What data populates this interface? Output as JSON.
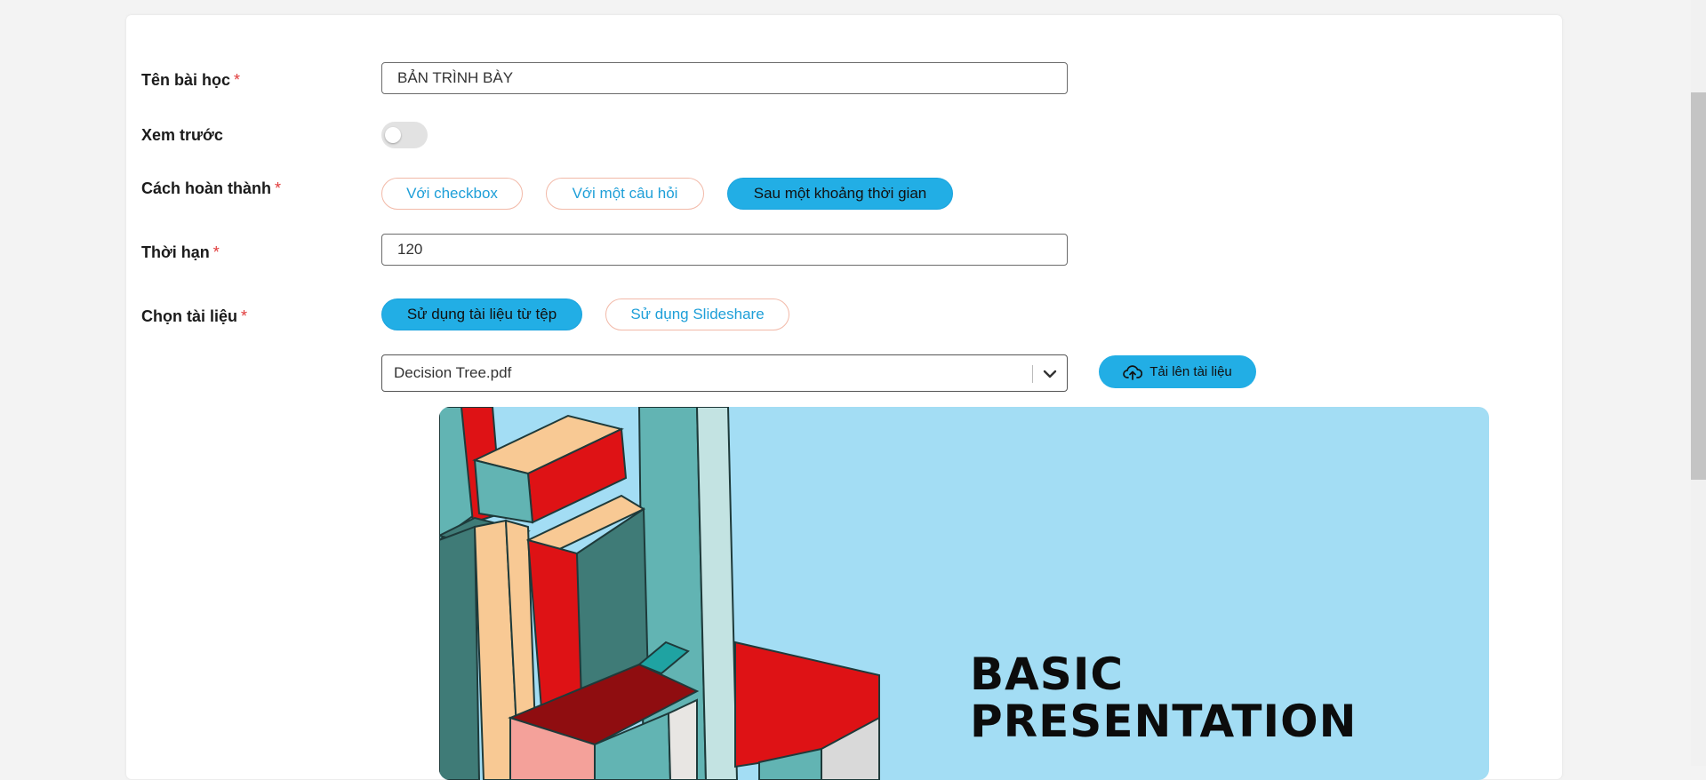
{
  "form": {
    "lesson_name": {
      "label": "Tên bài học",
      "required_mark": "*",
      "value": "BẢN TRÌNH BÀY"
    },
    "preview": {
      "label": "Xem trước",
      "enabled": false
    },
    "completion": {
      "label": "Cách hoàn thành",
      "required_mark": "*",
      "options": [
        "Với checkbox",
        "Với một câu hỏi",
        "Sau một khoảng thời gian"
      ],
      "selected": "Sau một khoảng thời gian"
    },
    "duration": {
      "label": "Thời hạn",
      "required_mark": "*",
      "value": "120"
    },
    "document": {
      "label": "Chọn tài liệu",
      "required_mark": "*",
      "options": [
        "Sử dụng tài liệu từ tệp",
        "Sử dụng Slideshare"
      ],
      "selected": "Sử dụng tài liệu từ tệp",
      "file": "Decision Tree.pdf",
      "upload_label": "Tải lên tài liệu"
    }
  },
  "slide_preview": {
    "title_line1": "BASIC",
    "title_line2": "PRESENTATION"
  },
  "colors": {
    "accent": "#22aee5",
    "outline_border": "#f2b9a8",
    "outline_text": "#1e9fd8",
    "required": "#e03a3a"
  },
  "icons": [
    "upload-cloud-icon",
    "chevron-down-icon"
  ]
}
